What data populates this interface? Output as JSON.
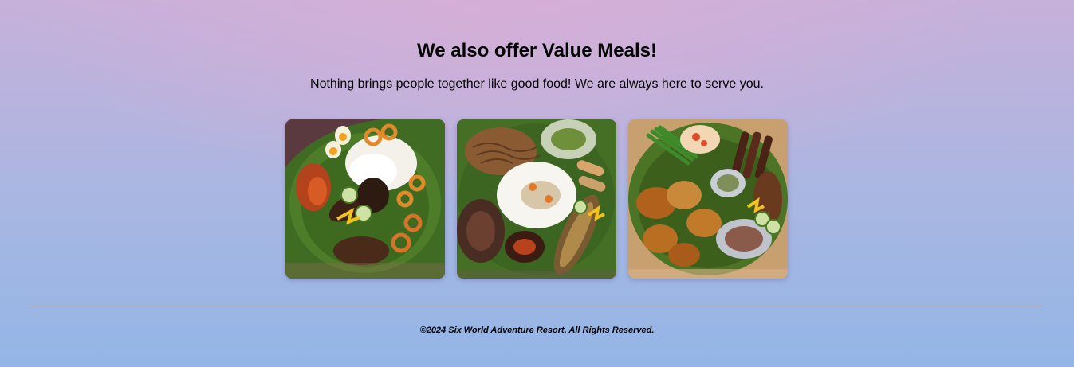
{
  "value_meals": {
    "title": "We also offer Value Meals!",
    "subtitle": "Nothing brings people together like good food! We are always here to serve you.",
    "photos": [
      {
        "alt": "Boodle fight platter with grilled seafood, rice and shrimp",
        "icon": "food-photo"
      },
      {
        "alt": "Boodle fight platter with pancit, rice, grilled fish and lumpia",
        "icon": "food-photo"
      },
      {
        "alt": "Boodle fight platter with grilled meats, vegetables and barbecue skewers",
        "icon": "food-photo"
      }
    ]
  },
  "footer": {
    "copyright": "©2024 Six World Adventure Resort. All Rights Reserved."
  },
  "colors": {
    "background_top": "#d7aed6",
    "background_bottom": "#93b6e6",
    "divider": "#e6e8f2",
    "banana_leaf": "#3f6b22"
  }
}
